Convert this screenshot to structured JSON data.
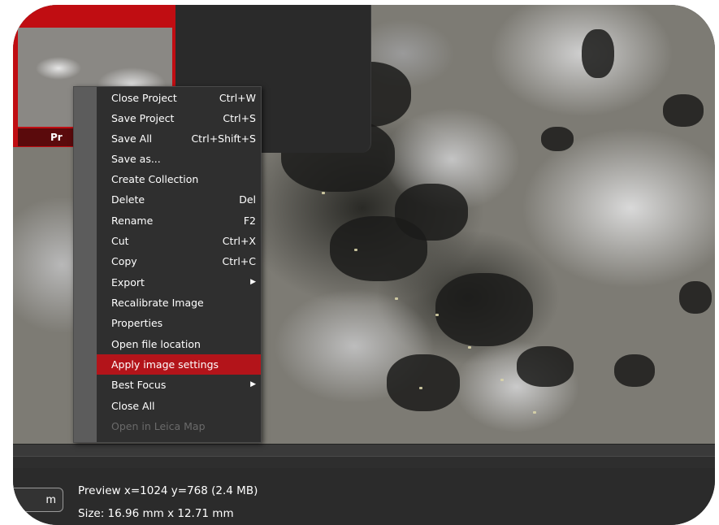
{
  "thumbnail": {
    "caption": "Pr"
  },
  "context_menu": {
    "items": [
      {
        "label": "Close Project",
        "shortcut": "Ctrl+W"
      },
      {
        "label": "Save Project",
        "shortcut": "Ctrl+S"
      },
      {
        "label": "Save All",
        "shortcut": "Ctrl+Shift+S"
      },
      {
        "label": "Save as...",
        "shortcut": ""
      },
      {
        "label": "Create Collection",
        "shortcut": ""
      },
      {
        "label": "Delete",
        "shortcut": "Del"
      },
      {
        "label": "Rename",
        "shortcut": "F2"
      },
      {
        "label": "Cut",
        "shortcut": "Ctrl+X"
      },
      {
        "label": "Copy",
        "shortcut": "Ctrl+C"
      },
      {
        "label": "Export",
        "shortcut": "▶"
      },
      {
        "label": "Recalibrate Image",
        "shortcut": ""
      },
      {
        "label": "Properties",
        "shortcut": ""
      },
      {
        "label": "Open file location",
        "shortcut": ""
      },
      {
        "label": "Apply image settings",
        "shortcut": ""
      },
      {
        "label": "Best Focus",
        "shortcut": "▶"
      },
      {
        "label": "Close All",
        "shortcut": ""
      },
      {
        "label": "Open in Leica Map",
        "shortcut": ""
      }
    ],
    "highlighted_item": "Apply image settings",
    "disabled_item": "Open in Leica Map",
    "highlight_color": "#b3141a"
  },
  "status": {
    "zoom_button_label": "m",
    "preview_line": "Preview x=1024 y=768  (2.4 MB)",
    "size_line": "Size: 16.96 mm x 12.71 mm"
  },
  "colors": {
    "accent": "#c00d12",
    "background": "#2b2b2b",
    "menu_bg": "#2f2f2f"
  }
}
